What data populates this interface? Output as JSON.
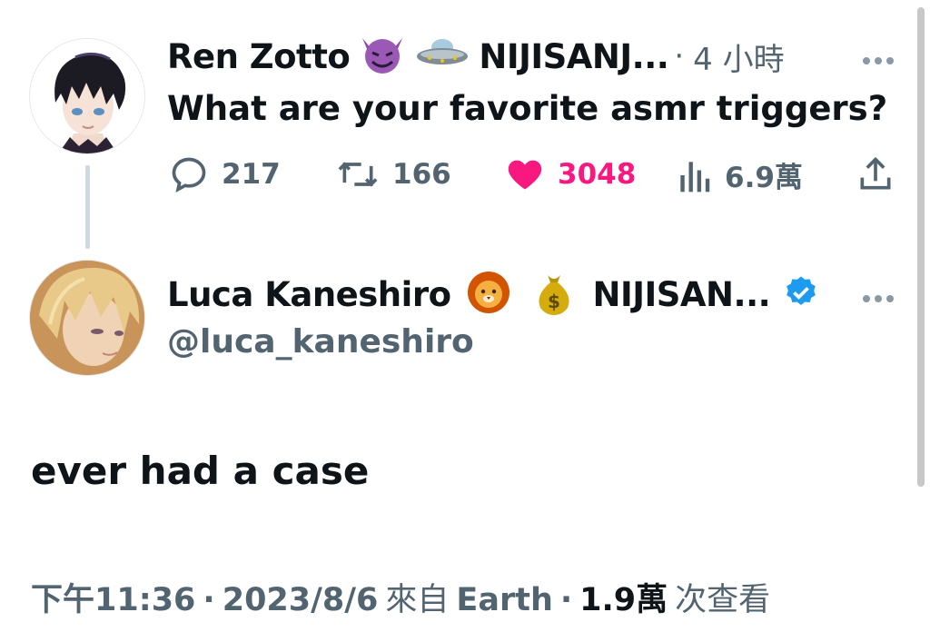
{
  "parent_tweet": {
    "display_name": "Ren Zotto",
    "emojis": [
      "smiling-imp-emoji",
      "ufo-emoji"
    ],
    "name_suffix": "NIJISANJ...",
    "dot": "·",
    "time": "4 小時",
    "text": "What are your favorite asmr triggers?",
    "stats": {
      "replies": "217",
      "retweets": "166",
      "likes": "3048",
      "views": "6.9萬"
    },
    "liked": true
  },
  "reply_tweet": {
    "display_name": "Luca Kaneshiro",
    "emojis": [
      "lion-emoji",
      "money-bag-emoji"
    ],
    "name_suffix": "NIJISAN...",
    "verified": true,
    "handle": "@luca_kaneshiro",
    "text": "ever had a case",
    "meta": {
      "time": "下午11:36",
      "sep1": "·",
      "date": "2023/8/6",
      "from_label": "來自",
      "source": "Earth",
      "sep2": "·",
      "views_count": "1.9萬",
      "views_label": "次查看"
    }
  },
  "colors": {
    "text": "#0f1419",
    "muted": "#536471",
    "like": "#f91880",
    "verified": "#1d9bf0",
    "thread_line": "#cfd9de"
  }
}
